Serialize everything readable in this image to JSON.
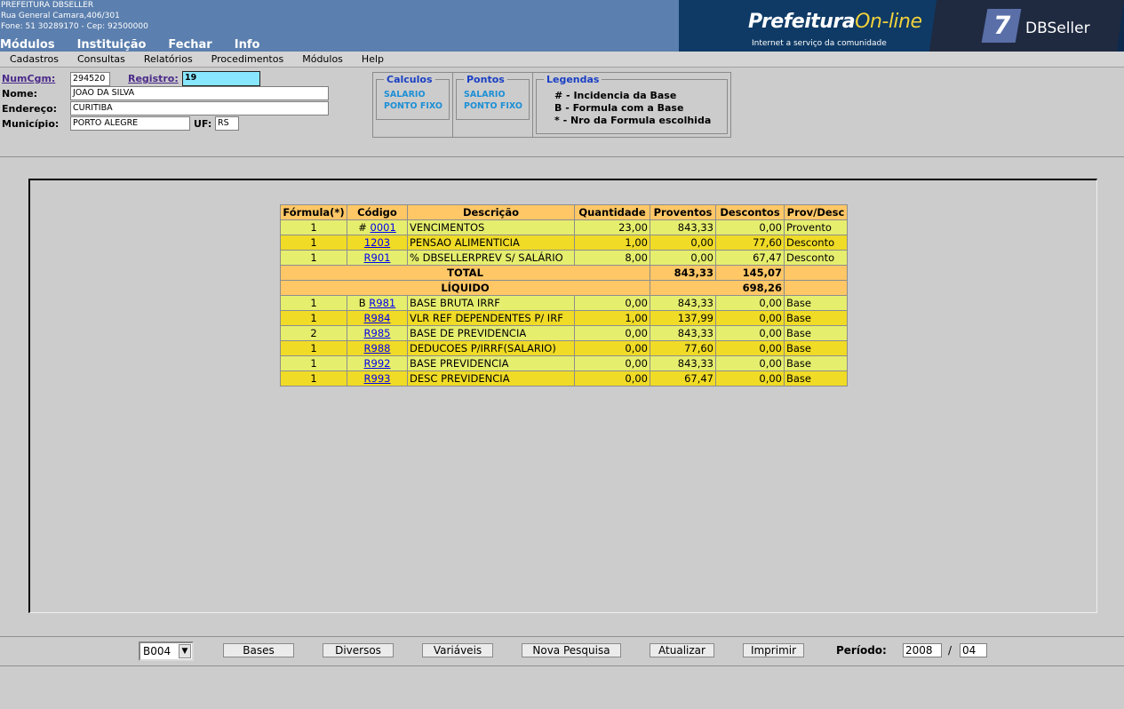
{
  "header": {
    "org_lines": [
      "PREFEITURA DBSELLER",
      "Rua General Camara,406/301",
      "Fone: 51 30289170  -  Cep: 92500000"
    ],
    "nav": [
      "Módulos",
      "Instituição",
      "Fechar",
      "Info"
    ],
    "brand": {
      "prefeitura": "Prefeitura",
      "online": "On-line",
      "tagline": "Internet a serviço da comunidade",
      "dbseller": "DBSeller"
    }
  },
  "menu": [
    "Cadastros",
    "Consultas",
    "Relatórios",
    "Procedimentos",
    "Módulos",
    "Help"
  ],
  "form": {
    "numcgm_label": "NumCgm:",
    "numcgm_value": "294520",
    "registro_label": "Registro:",
    "registro_value": "19",
    "nome_label": "Nome:",
    "nome_value": "JOAO DA SILVA",
    "endereco_label": "Endereço:",
    "endereco_value": "CURITIBA",
    "municipio_label": "Município:",
    "municipio_value": "PORTO ALEGRE",
    "uf_label": "UF:",
    "uf_value": "RS"
  },
  "calculos": {
    "legend": "Calculos",
    "links": [
      "SALARIO",
      "PONTO FIXO"
    ]
  },
  "pontos": {
    "legend": "Pontos",
    "links": [
      "SALARIO",
      "PONTO FIXO"
    ]
  },
  "legendas": {
    "legend": "Legendas",
    "lines": [
      "# - Incidencia da Base",
      "B - Formula com a Base",
      "* - Nro da Formula escolhida"
    ]
  },
  "table": {
    "headers": [
      "Fórmula(*)",
      "Código",
      "Descrição",
      "Quantidade",
      "Proventos",
      "Descontos",
      "Prov/Desc"
    ],
    "rows": [
      {
        "formula": "1",
        "prefix": "#",
        "codigo": "0001",
        "descricao": "VENCIMENTOS",
        "quantidade": "23,00",
        "proventos": "843,33",
        "descontos": "0,00",
        "tipo": "Provento"
      },
      {
        "formula": "1",
        "prefix": "",
        "codigo": "1203",
        "descricao": "PENSAO ALIMENTICIA",
        "quantidade": "1,00",
        "proventos": "0,00",
        "descontos": "77,60",
        "tipo": "Desconto"
      },
      {
        "formula": "1",
        "prefix": "",
        "codigo": "R901",
        "descricao": "% DBSELLERPREV S/ SALÁRIO",
        "quantidade": "8,00",
        "proventos": "0,00",
        "descontos": "67,47",
        "tipo": "Desconto"
      }
    ],
    "total": {
      "label": "TOTAL",
      "proventos": "843,33",
      "descontos": "145,07"
    },
    "liquido": {
      "label": "LÍQUIDO",
      "value": "698,26"
    },
    "base_rows": [
      {
        "formula": "1",
        "prefix": "B",
        "codigo": "R981",
        "descricao": "BASE BRUTA IRRF",
        "quantidade": "0,00",
        "proventos": "843,33",
        "descontos": "0,00",
        "tipo": "Base"
      },
      {
        "formula": "1",
        "prefix": "",
        "codigo": "R984",
        "descricao": "VLR REF DEPENDENTES P/ IRF",
        "quantidade": "1,00",
        "proventos": "137,99",
        "descontos": "0,00",
        "tipo": "Base"
      },
      {
        "formula": "2",
        "prefix": "",
        "codigo": "R985",
        "descricao": "BASE DE PREVIDENCIA",
        "quantidade": "0,00",
        "proventos": "843,33",
        "descontos": "0,00",
        "tipo": "Base"
      },
      {
        "formula": "1",
        "prefix": "",
        "codigo": "R988",
        "descricao": "DEDUCOES P/IRRF(SALARIO)",
        "quantidade": "0,00",
        "proventos": "77,60",
        "descontos": "0,00",
        "tipo": "Base"
      },
      {
        "formula": "1",
        "prefix": "",
        "codigo": "R992",
        "descricao": "BASE PREVIDENCIA",
        "quantidade": "0,00",
        "proventos": "843,33",
        "descontos": "0,00",
        "tipo": "Base"
      },
      {
        "formula": "1",
        "prefix": "",
        "codigo": "R993",
        "descricao": "DESC PREVIDENCIA",
        "quantidade": "0,00",
        "proventos": "67,47",
        "descontos": "0,00",
        "tipo": "Base"
      }
    ]
  },
  "footer": {
    "select_value": "B004",
    "buttons": [
      "Bases",
      "Diversos",
      "Variáveis",
      "Nova Pesquisa",
      "Atualizar",
      "Imprimir"
    ],
    "periodo_label": "Período:",
    "ano": "2008",
    "separator": "/",
    "mes": "04"
  },
  "colors": {
    "header_bg": "#5b7fae",
    "row_odd": "#e6ee6e",
    "row_even": "#f0db26",
    "header_cell": "#ffc766",
    "link": "#1d8fd6"
  }
}
